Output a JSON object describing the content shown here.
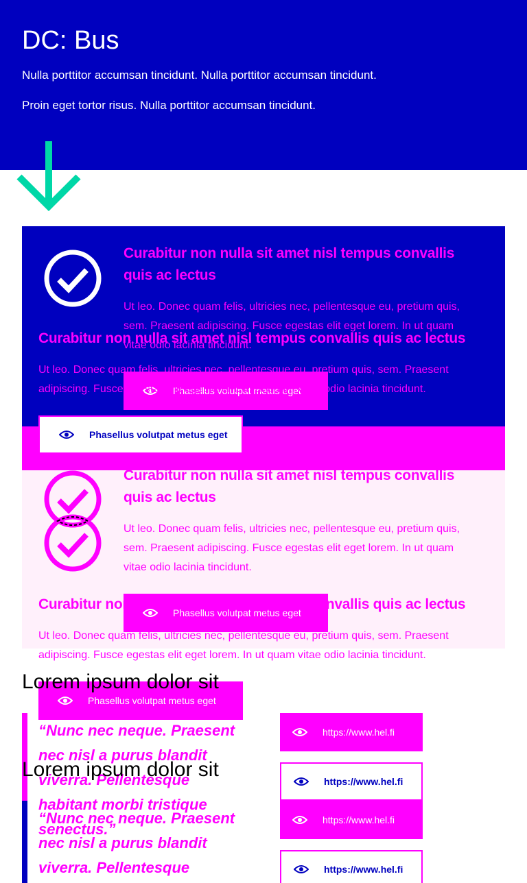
{
  "hero": {
    "title": "DC: Bus",
    "paragraphs": [
      "Nulla porttitor accumsan tincidunt. Nulla porttitor accumsan tincidunt.",
      "Proin eget tortor risus. Nulla porttitor accumsan tincidunt."
    ]
  },
  "icons": {
    "arrow": "arrow-down-icon",
    "check": "check-circle-icon",
    "eye": "eye-icon"
  },
  "colors": {
    "brand_blue": "#0000bf",
    "accent": "#ff00ff",
    "arrow": "#00d7a7",
    "pink_bg": "#fff0fb"
  },
  "cards": [
    {
      "title_line1": "Curabitur non nulla sit amet nisl tempus convallis",
      "title_line2": "quis ac lectus",
      "text_line1": "Ut leo. Donec quam felis, ultricies nec, pellentesque eu, pretium quis,",
      "text_line2": "sem. Praesent adipiscing. Fusce egestas elit eget lorem. In ut quam",
      "text_line3": "vitae odio lacinia tincidunt."
    },
    {
      "title": "Curabitur non nulla sit amet nisl tempus convallis quis ac lectus",
      "text_line1": "Ut leo. Donec quam felis, ultricies nec, pellentesque eu, pretium quis, sem. Praesent",
      "text_line2": "adipiscing. Fusce egestas elit eget lorem. In ut quam vitae odio lacinia tincidunt."
    },
    {
      "title_line1": "Curabitur non nulla sit amet nisl tempus convallis",
      "title_line2": "quis ac lectus",
      "text_line1": "Ut leo. Donec quam felis, ultricies nec, pellentesque eu, pretium quis,",
      "text_line2": "sem. Praesent adipiscing. Fusce egestas elit eget lorem. In ut quam",
      "text_line3": "vitae odio lacinia tincidunt."
    },
    {
      "title": "Curabitur non nulla sit amet nisl tempus convallis quis ac lectus",
      "text_line1": "Ut leo. Donec quam felis, ultricies nec, pellentesque eu, pretium quis, sem. Praesent",
      "text_line2": "adipiscing. Fusce egestas elit eget lorem. In ut quam vitae odio lacinia tincidunt."
    }
  ],
  "buttons": {
    "view_label": "Phasellus volutpat metus eget"
  },
  "section": {
    "heading": "Lorem ipsum dolor sit",
    "quote_lines": [
      "“Nunc nec neque. Praesent",
      "nec nisl a purus blandit",
      "viverra. Pellentesque",
      "habitant morbi tristique",
      "senectus.”"
    ],
    "link_label": "https://www.hel.fi"
  }
}
